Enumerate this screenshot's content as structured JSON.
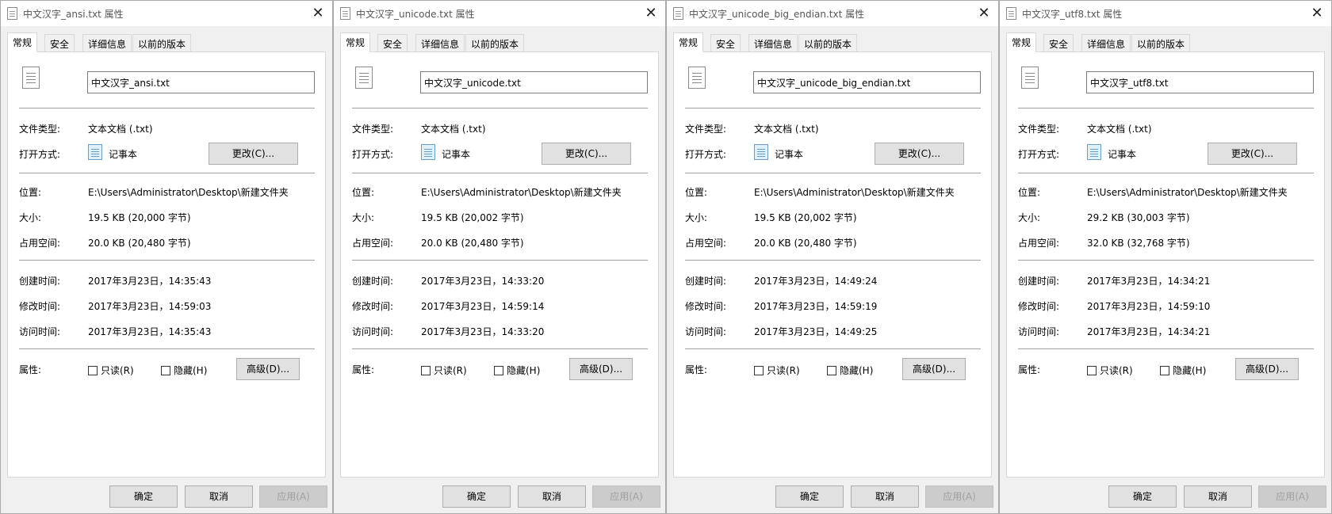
{
  "tab_labels": [
    "常规",
    "安全",
    "详细信息",
    "以前的版本"
  ],
  "labels": {
    "file_type": "文件类型:",
    "open_with": "打开方式:",
    "location": "位置:",
    "size": "大小:",
    "size_on_disk": "占用空间:",
    "created": "创建时间:",
    "modified": "修改时间:",
    "accessed": "访问时间:",
    "attributes": "属性:"
  },
  "buttons": {
    "change": "更改(C)...",
    "advanced": "高级(D)...",
    "ok": "确定",
    "cancel": "取消",
    "apply": "应用(A)"
  },
  "checkboxes": {
    "readonly": "只读(R)",
    "hidden": "隐藏(H)"
  },
  "icons": {
    "close": "close-icon",
    "file": "text-file-icon",
    "notepad": "notepad-icon"
  },
  "dialogs": [
    {
      "title": "中文汉字_ansi.txt 属性",
      "filename": "中文汉字_ansi.txt",
      "file_type": "文本文档 (.txt)",
      "open_with": "记事本",
      "location": "E:\\Users\\Administrator\\Desktop\\新建文件夹",
      "size": "19.5 KB (20,000 字节)",
      "size_on_disk": "20.0 KB (20,480 字节)",
      "created": "2017年3月23日，14:35:43",
      "modified": "2017年3月23日，14:59:03",
      "accessed": "2017年3月23日，14:35:43"
    },
    {
      "title": "中文汉字_unicode.txt 属性",
      "filename": "中文汉字_unicode.txt",
      "file_type": "文本文档 (.txt)",
      "open_with": "记事本",
      "location": "E:\\Users\\Administrator\\Desktop\\新建文件夹",
      "size": "19.5 KB (20,002 字节)",
      "size_on_disk": "20.0 KB (20,480 字节)",
      "created": "2017年3月23日，14:33:20",
      "modified": "2017年3月23日，14:59:14",
      "accessed": "2017年3月23日，14:33:20"
    },
    {
      "title": "中文汉字_unicode_big_endian.txt 属性",
      "filename": "中文汉字_unicode_big_endian.txt",
      "file_type": "文本文档 (.txt)",
      "open_with": "记事本",
      "location": "E:\\Users\\Administrator\\Desktop\\新建文件夹",
      "size": "19.5 KB (20,002 字节)",
      "size_on_disk": "20.0 KB (20,480 字节)",
      "created": "2017年3月23日，14:49:24",
      "modified": "2017年3月23日，14:59:19",
      "accessed": "2017年3月23日，14:49:25"
    },
    {
      "title": "中文汉字_utf8.txt 属性",
      "filename": "中文汉字_utf8.txt",
      "file_type": "文本文档 (.txt)",
      "open_with": "记事本",
      "location": "E:\\Users\\Administrator\\Desktop\\新建文件夹",
      "size": "29.2 KB (30,003 字节)",
      "size_on_disk": "32.0 KB (32,768 字节)",
      "created": "2017年3月23日，14:34:21",
      "modified": "2017年3月23日，14:59:10",
      "accessed": "2017年3月23日，14:34:21"
    }
  ]
}
